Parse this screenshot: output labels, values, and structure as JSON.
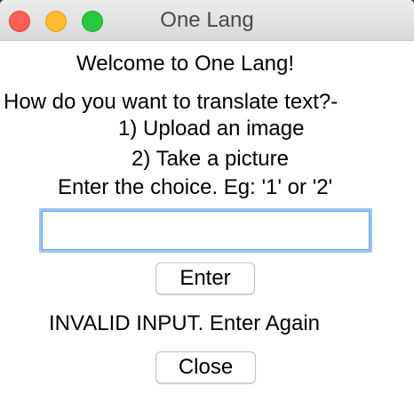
{
  "window": {
    "title": "One Lang"
  },
  "content": {
    "welcome": "Welcome to One Lang!",
    "question": "How do you want to translate text?-",
    "option_1": "1) Upload an image",
    "option_2": "2) Take a picture",
    "hint": "Enter the choice. Eg: '1' or '2'",
    "input_value": "",
    "enter_label": "Enter",
    "status_message": "INVALID INPUT. Enter Again",
    "close_label": "Close"
  },
  "colors": {
    "traffic_close": "#fc5f57",
    "traffic_minimize": "#fdbc2e",
    "traffic_maximize": "#28c840",
    "input_focus_ring": "#9cc4f2"
  }
}
